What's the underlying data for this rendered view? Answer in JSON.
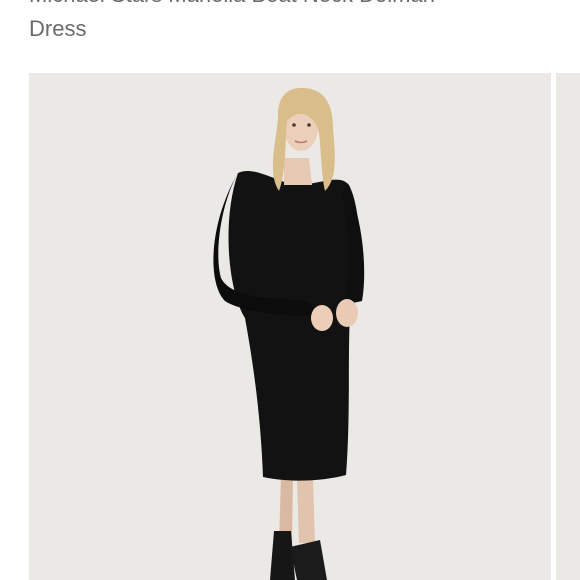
{
  "product": {
    "title_line1": "Michael Stars Mariella Boat Neck Dolman",
    "title_line2": "Dress"
  },
  "gallery": {
    "image_subject": "model-wearing-black-dress",
    "background_color": "#ebe9e5",
    "dress_color": "#121212"
  }
}
